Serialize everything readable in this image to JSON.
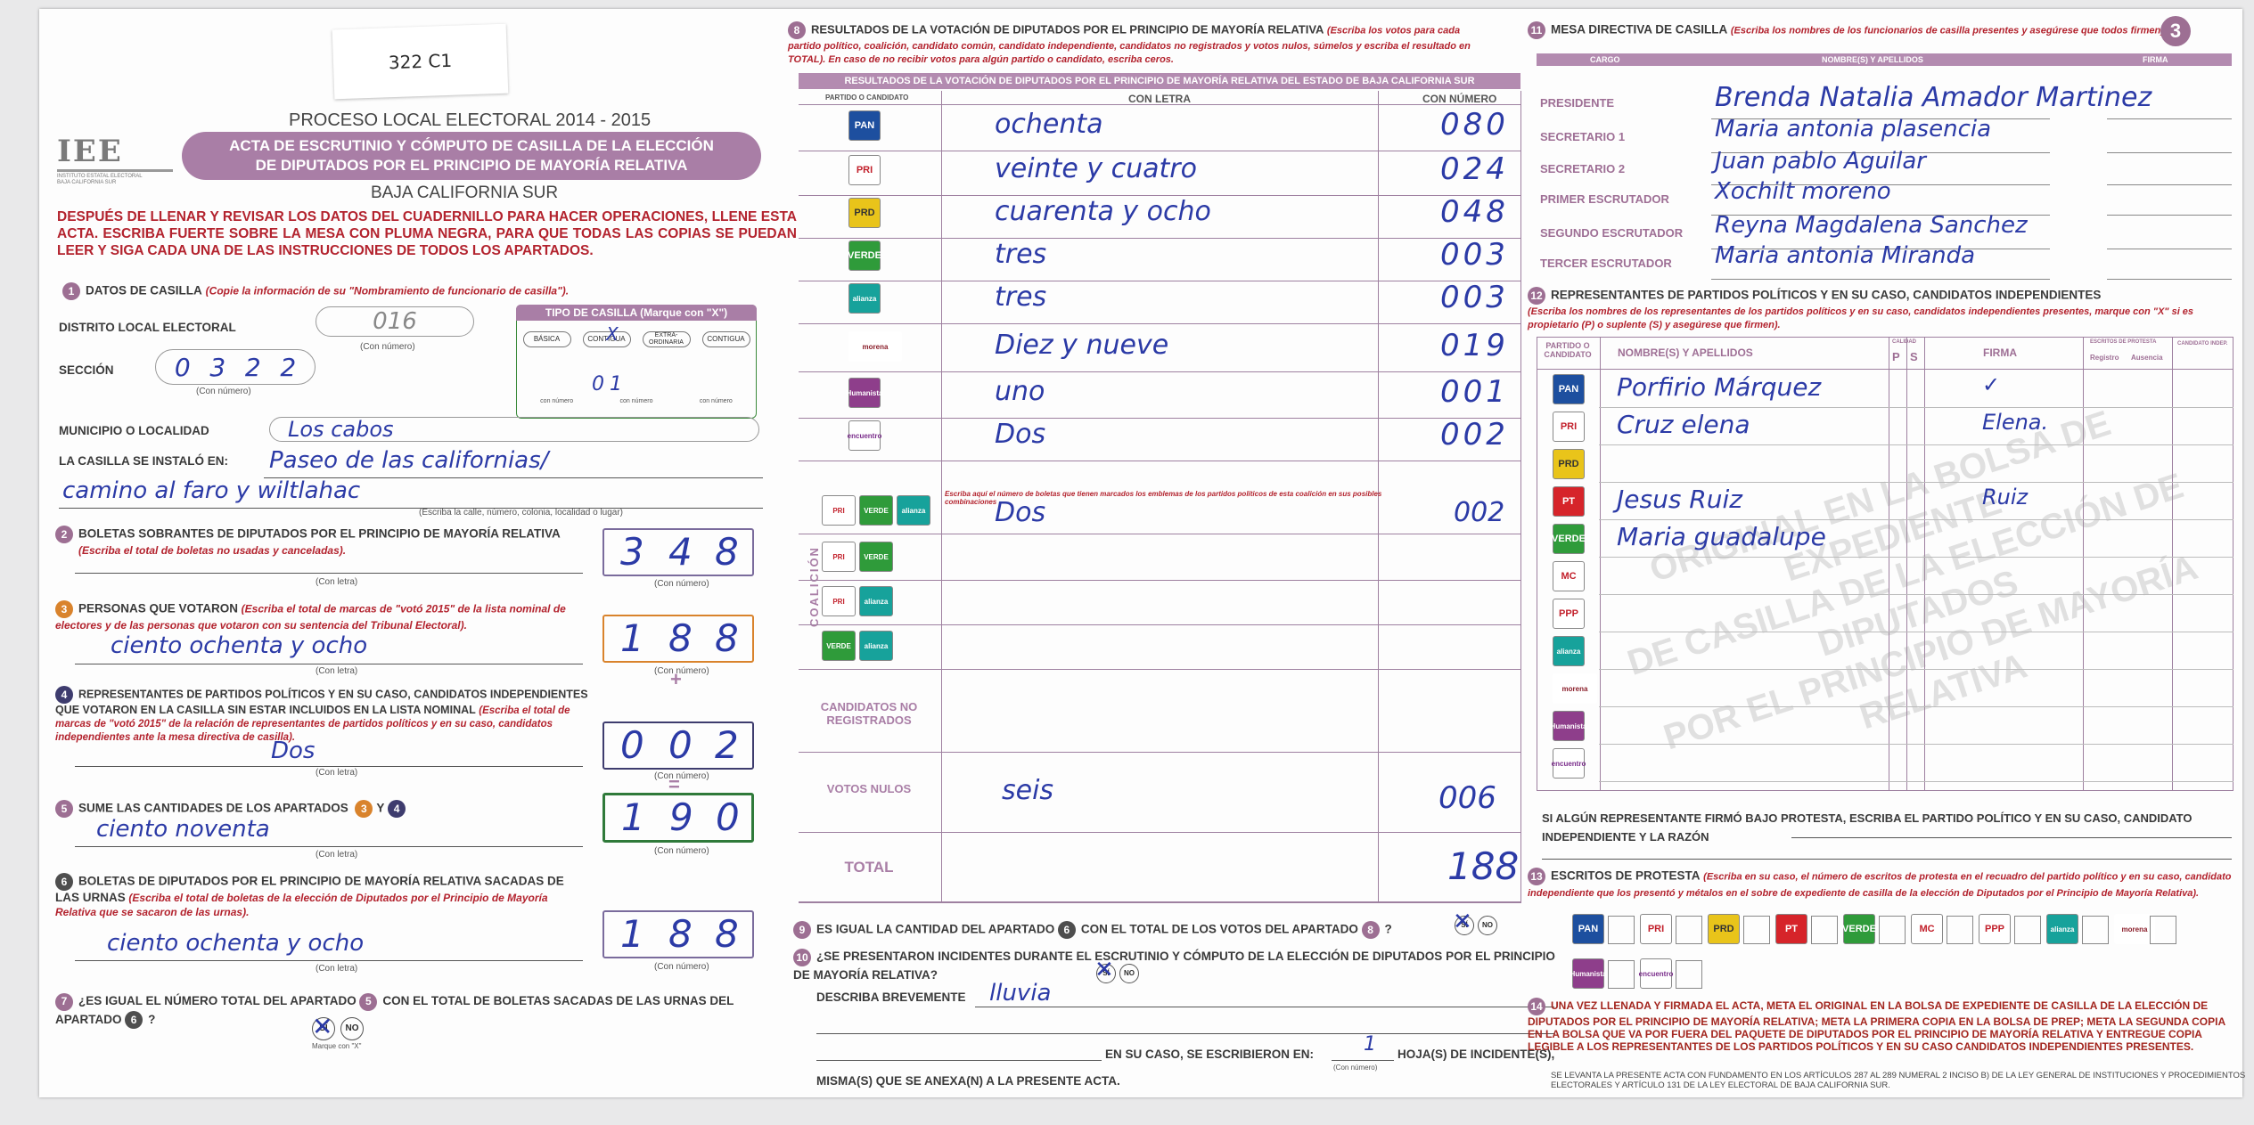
{
  "header": {
    "sticker": "322 C1",
    "process": "PROCESO LOCAL ELECTORAL 2014 - 2015",
    "title_line1": "ACTA DE ESCRUTINIO Y CÓMPUTO DE CASILLA DE LA ELECCIÓN",
    "title_line2": "DE DIPUTADOS POR EL PRINCIPIO DE MAYORÍA RELATIVA",
    "state": "BAJA CALIFORNIA SUR",
    "logo": "IEE",
    "logo_sub": "INSTITUTO ESTATAL ELECTORAL BAJA CALIFORNIA SUR",
    "instructions": "DESPUÉS DE LLENAR Y REVISAR LOS DATOS DEL CUADERNILLO PARA HACER OPERACIONES, LLENE ESTA ACTA. ESCRIBA FUERTE SOBRE LA MESA CON PLUMA NEGRA, PARA QUE TODAS LAS COPIAS SE PUEDAN LEER Y SIGA CADA UNA DE LAS INSTRUCCIONES DE TODOS LOS APARTADOS.",
    "page_num": "3"
  },
  "s1": {
    "title": "DATOS DE CASILLA",
    "note": "(Copie la información de su \"Nombramiento de funcionario de casilla\").",
    "distrito_label": "DISTRITO LOCAL ELECTORAL",
    "distrito": "016",
    "con_numero": "(Con número)",
    "seccion_label": "SECCIÓN",
    "seccion": [
      "0",
      "3",
      "2",
      "2"
    ],
    "tipo_title": "TIPO DE CASILLA (Marque con \"X\")",
    "tipos": [
      "BÁSICA",
      "CONTIGUA",
      "EXTRA-ORDINARIA",
      "CONTIGUA"
    ],
    "tipo_mark": "X",
    "tipo_num": "01",
    "con_num_small": "con número",
    "municipio_label": "MUNICIPIO O LOCALIDAD",
    "municipio": "Los cabos",
    "instalo_label": "LA CASILLA SE INSTALÓ EN:",
    "instalo1": "Paseo de las californias/",
    "instalo2": "camino al faro y wiltlahac",
    "instalo_note": "(Escriba la calle, número, colonia, localidad o lugar)"
  },
  "s2": {
    "title": "BOLETAS SOBRANTES DE DIPUTADOS POR EL PRINCIPIO DE MAYORÍA RELATIVA",
    "note": "(Escriba el total de boletas no usadas y canceladas).",
    "digits": [
      "3",
      "4",
      "8"
    ],
    "con_letra": "(Con letra)",
    "con_numero": "(Con número)"
  },
  "s3": {
    "title": "PERSONAS QUE VOTARON",
    "note": "(Escriba el total de marcas de \"votó 2015\" de la lista nominal de electores y de las personas que votaron con su sentencia del Tribunal Electoral).",
    "letra": "ciento ochenta y ocho",
    "digits": [
      "1",
      "8",
      "8"
    ],
    "plus": "+"
  },
  "s4": {
    "title": "REPRESENTANTES DE PARTIDOS POLÍTICOS Y EN SU CASO, CANDIDATOS INDEPENDIENTES QUE VOTARON EN LA CASILLA SIN ESTAR INCLUIDOS EN LA LISTA NOMINAL",
    "note": "(Escriba el total de marcas de \"votó 2015\" de la relación de representantes de partidos políticos y en su caso, candidatos independientes ante la mesa directiva de casilla).",
    "letra": "Dos",
    "digits": [
      "0",
      "0",
      "2"
    ],
    "eq": "="
  },
  "s5": {
    "title": "SUME LAS CANTIDADES DE LOS APARTADOS",
    "y": "Y",
    "letra": "ciento noventa",
    "digits": [
      "1",
      "9",
      "0"
    ]
  },
  "s6": {
    "title": "BOLETAS DE DIPUTADOS POR EL PRINCIPIO DE MAYORÍA RELATIVA SACADAS DE LAS URNAS",
    "note": "(Escriba el total de boletas de la elección de Diputados por el Principio de Mayoría Relativa que se sacaron de las urnas).",
    "letra": "ciento ochenta y ocho",
    "digits": [
      "1",
      "8",
      "8"
    ]
  },
  "s7": {
    "title": "¿ES IGUAL EL NÚMERO TOTAL DEL APARTADO",
    "mid": "CON EL TOTAL DE BOLETAS SACADAS DE LAS URNAS DEL APARTADO",
    "q": "?",
    "si": "SÍ",
    "no": "NO",
    "marque": "Marque con \"X\""
  },
  "s8": {
    "title": "RESULTADOS DE LA VOTACIÓN DE DIPUTADOS POR EL PRINCIPIO DE MAYORÍA RELATIVA",
    "note": "(Escriba los votos para cada partido político, coalición, candidato común, candidato independiente, candidatos no registrados y votos nulos, súmelos y escriba el resultado en TOTAL). En caso de no recibir votos para algún partido o candidato, escriba ceros.",
    "band": "RESULTADOS DE LA VOTACIÓN DE DIPUTADOS POR EL PRINCIPIO DE MAYORÍA RELATIVA DEL ESTADO DE BAJA CALIFORNIA SUR",
    "col_party": "PARTIDO O CANDIDATO",
    "col_letra": "CON LETRA",
    "col_num": "CON NÚMERO",
    "rows": [
      {
        "party": "PAN",
        "letra": "ochenta",
        "num": "080"
      },
      {
        "party": "PRI",
        "letra": "veinte y cuatro",
        "num": "024"
      },
      {
        "party": "PRD",
        "letra": "cuarenta y ocho",
        "num": "048"
      },
      {
        "party": "VERDE",
        "letra": "tres",
        "num": "003"
      },
      {
        "party": "alianza",
        "letra": "tres",
        "num": "003"
      },
      {
        "party": "morena",
        "letra": "Diez y nueve",
        "num": "019"
      },
      {
        "party": "Humanista",
        "letra": "uno",
        "num": "001"
      },
      {
        "party": "encuentro",
        "letra": "Dos",
        "num": "002"
      }
    ],
    "coal_label": "COALICIÓN",
    "coal_note": "Escriba aquí el número de boletas que tienen marcados los emblemas de los partidos políticos de esta coalición en sus posibles combinaciones",
    "coal_rows": [
      {
        "letra": "Dos",
        "num": "002"
      },
      {
        "letra": "",
        "num": ""
      },
      {
        "letra": "",
        "num": ""
      },
      {
        "letra": "",
        "num": ""
      }
    ],
    "no_reg": "CANDIDATOS NO REGISTRADOS",
    "nulos": "VOTOS NULOS",
    "nulos_letra": "seis",
    "nulos_num": "006",
    "total": "TOTAL",
    "total_num": "188"
  },
  "s9": {
    "title": "ES IGUAL LA CANTIDAD DEL APARTADO",
    "mid": "CON EL TOTAL DE LOS VOTOS DEL APARTADO",
    "q": "?",
    "si": "SÍ",
    "no": "NO"
  },
  "s10": {
    "title": "¿SE PRESENTARON INCIDENTES DURANTE EL ESCRUTINIO Y CÓMPUTO DE LA ELECCIÓN DE DIPUTADOS POR EL PRINCIPIO DE MAYORÍA RELATIVA?",
    "si": "SÍ",
    "no": "NO",
    "describa": "DESCRIBA BREVEMENTE",
    "desc": "lluvia",
    "escribieron": "EN SU CASO, SE ESCRIBIERON EN:",
    "hojas_num": "1",
    "hojas": "HOJA(S) DE INCIDENTE(S),",
    "con_numero": "(Con número)",
    "anexa": "MISMA(S) QUE SE ANEXA(N) A LA PRESENTE ACTA."
  },
  "s11": {
    "title": "MESA DIRECTIVA DE CASILLA",
    "note": "(Escriba los nombres de los funcionarios de casilla presentes y asegúrese que todos firmen).",
    "col_cargo": "CARGO",
    "col_nombre": "NOMBRE(S) Y APELLIDOS",
    "col_firma": "FIRMA",
    "rows": [
      {
        "cargo": "PRESIDENTE",
        "nombre": "Brenda Natalia Amador Martinez"
      },
      {
        "cargo": "SECRETARIO 1",
        "nombre": "Maria antonia plasencia"
      },
      {
        "cargo": "SECRETARIO 2",
        "nombre": "Juan pablo Aguilar"
      },
      {
        "cargo": "PRIMER ESCRUTADOR",
        "nombre": "Xochilt moreno"
      },
      {
        "cargo": "SEGUNDO ESCRUTADOR",
        "nombre": "Reyna Magdalena Sanchez"
      },
      {
        "cargo": "TERCER ESCRUTADOR",
        "nombre": "Maria antonia Miranda"
      }
    ]
  },
  "s12": {
    "title": "REPRESENTANTES DE PARTIDOS POLÍTICOS Y EN SU CASO, CANDIDATOS INDEPENDIENTES",
    "note": "(Escriba los nombres de los representantes de los partidos políticos y en su caso, candidatos independientes presentes, marque con \"X\" si es propietario (P) o suplente (S) y asegúrese que firmen).",
    "col_party": "PARTIDO O CANDIDATO",
    "col_nombre": "NOMBRE(S) Y APELLIDOS",
    "col_calidad": "CALIDAD",
    "col_p": "P",
    "col_s": "S",
    "col_firma": "FIRMA",
    "col_escritos": "ESCRITOS DE PROTESTA",
    "col_reg": "Registro",
    "col_aus": "Ausencia",
    "col_iden": "CANDIDATO INDEP.",
    "parties": [
      "PAN",
      "PRI",
      "PRD",
      "PT",
      "VERDE",
      "MC",
      "PPP",
      "alianza",
      "morena",
      "Humanista",
      "encuentro"
    ],
    "names": [
      "Porfirio Márquez",
      "Cruz elena",
      "",
      "Jesus Ruiz",
      "Maria guadalupe",
      "",
      "",
      "",
      "",
      "",
      ""
    ],
    "firmas": [
      "✓",
      "Elena.",
      "",
      "Ruiz",
      "",
      ""
    ],
    "watermark1": "ORIGINAL EN LA BOLSA DE EXPEDIENTE",
    "watermark2": "DE CASILLA DE LA ELECCIÓN DE DIPUTADOS",
    "watermark3": "POR EL PRINCIPIO DE MAYORÍA RELATIVA",
    "protesta": "SI ALGÚN REPRESENTANTE FIRMÓ BAJO PROTESTA, ESCRIBA EL PARTIDO POLÍTICO Y EN SU CASO, CANDIDATO INDEPENDIENTE Y LA RAZÓN"
  },
  "s13": {
    "title": "ESCRITOS DE PROTESTA",
    "note": "(Escriba en su caso, el número de escritos de protesta en el recuadro del partido político y en su caso, candidato independiente que los presentó y métalos en el sobre de expediente de casilla de la elección de Diputados por el Principio de Mayoría Relativa)."
  },
  "s14": {
    "text": "UNA VEZ LLENADA Y FIRMADA EL ACTA, META EL ORIGINAL EN LA BOLSA DE EXPEDIENTE DE CASILLA DE LA ELECCIÓN DE DIPUTADOS POR EL PRINCIPIO DE MAYORÍA RELATIVA; META LA PRIMERA COPIA EN LA BOLSA DE PREP; META LA SEGUNDA COPIA EN LA BOLSA QUE VA POR FUERA DEL PAQUETE DE DIPUTADOS POR EL PRINCIPIO DE MAYORÍA RELATIVA Y ENTREGUE COPIA LEGIBLE A LOS REPRESENTANTES DE LOS PARTIDOS POLÍTICOS Y EN SU CASO CANDIDATOS INDEPENDIENTES PRESENTES.",
    "legal": "SE LEVANTA LA PRESENTE ACTA CON FUNDAMENTO EN LOS ARTÍCULOS 287 AL 289 NUMERAL 2 INCISO B) DE LA LEY GENERAL DE INSTITUCIONES Y PROCEDIMIENTOS ELECTORALES Y ARTÍCULO 131 DE LA LEY ELECTORAL DE BAJA CALIFORNIA SUR."
  }
}
